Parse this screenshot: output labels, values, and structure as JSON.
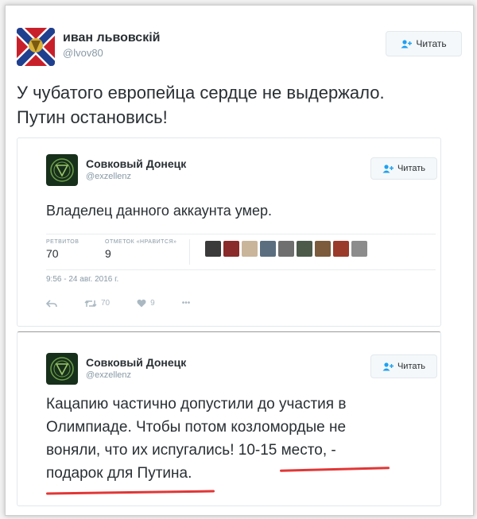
{
  "main_tweet": {
    "author_name": "иван львовскій",
    "handle": "@lvov80",
    "follow_label": "Читать",
    "text_line1": "У чубатого европейца сердце не выдержало.",
    "text_line2": "Путин остановись!"
  },
  "quoted_tweet_1": {
    "author_name": "Совковый Донецк",
    "handle": "@exzellenz",
    "follow_label": "Читать",
    "text": "Владелец данного аккаунта умер.",
    "retweets_label": "РЕТВИТОВ",
    "retweets_count": "70",
    "likes_label": "ОТМЕТОК «НРАВИТСЯ»",
    "likes_count": "9",
    "timestamp": "9:56 - 24 авг. 2016 г.",
    "action_retweet_count": "70",
    "action_like_count": "9",
    "more_label": "•••"
  },
  "quoted_tweet_2": {
    "author_name": "Совковый Донецк",
    "handle": "@exzellenz",
    "follow_label": "Читать",
    "text_line1": "Кацапию частично допустили до участия в",
    "text_line2": "Олимпиаде. Чтобы потом козломордые не",
    "text_line3_pre": "воняли, что их испугались! ",
    "text_line3_highlight": "10-15 место",
    "text_line3_post": ", -",
    "text_line4_highlight": "подарок для Путина",
    "text_line4_post": "."
  },
  "colors": {
    "highlight_underline": "#e23636",
    "name_text": "#292f33",
    "secondary_text": "#8899a6"
  },
  "icons": {
    "follow": "add-user-icon",
    "reply": "reply-icon",
    "retweet": "retweet-icon",
    "like": "heart-icon",
    "more": "more-icon"
  }
}
